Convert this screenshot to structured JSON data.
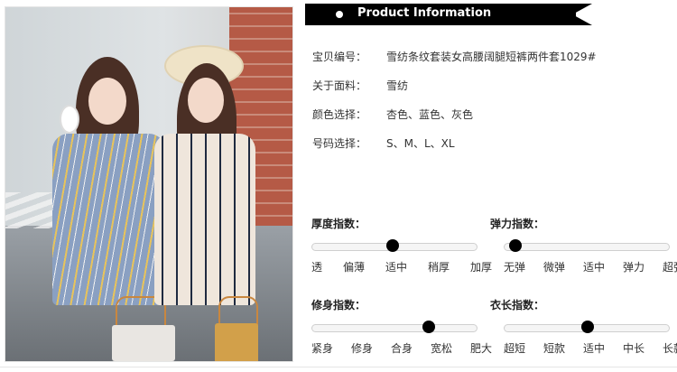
{
  "header": {
    "title": "Product Information"
  },
  "info": [
    {
      "label": "宝贝编号：",
      "value": "雪纺条纹套装女高腰阔腿短裤两件套1029#"
    },
    {
      "label": "关于面料：",
      "value": "雪纺"
    },
    {
      "label": "颜色选择：",
      "value": "杏色、蓝色、灰色"
    },
    {
      "label": "号码选择：",
      "value": "S、M、L、XL"
    }
  ],
  "indices": {
    "thickness": {
      "title": "厚度指数：",
      "ticks": [
        "透",
        "偏薄",
        "适中",
        "稍厚",
        "加厚"
      ],
      "selected": "适中"
    },
    "elasticity": {
      "title": "弹力指数：",
      "ticks": [
        "无弹",
        "微弹",
        "适中",
        "弹力",
        "超弹"
      ],
      "selected": "无弹"
    },
    "fit": {
      "title": "修身指数：",
      "ticks": [
        "紧身",
        "修身",
        "合身",
        "宽松",
        "肥大"
      ],
      "selected": "宽松"
    },
    "length": {
      "title": "衣长指数：",
      "ticks": [
        "超短",
        "短款",
        "适中",
        "中长",
        "长款"
      ],
      "selected": "适中"
    }
  },
  "colors": {
    "bar": "#000000",
    "knob": "#000000"
  }
}
